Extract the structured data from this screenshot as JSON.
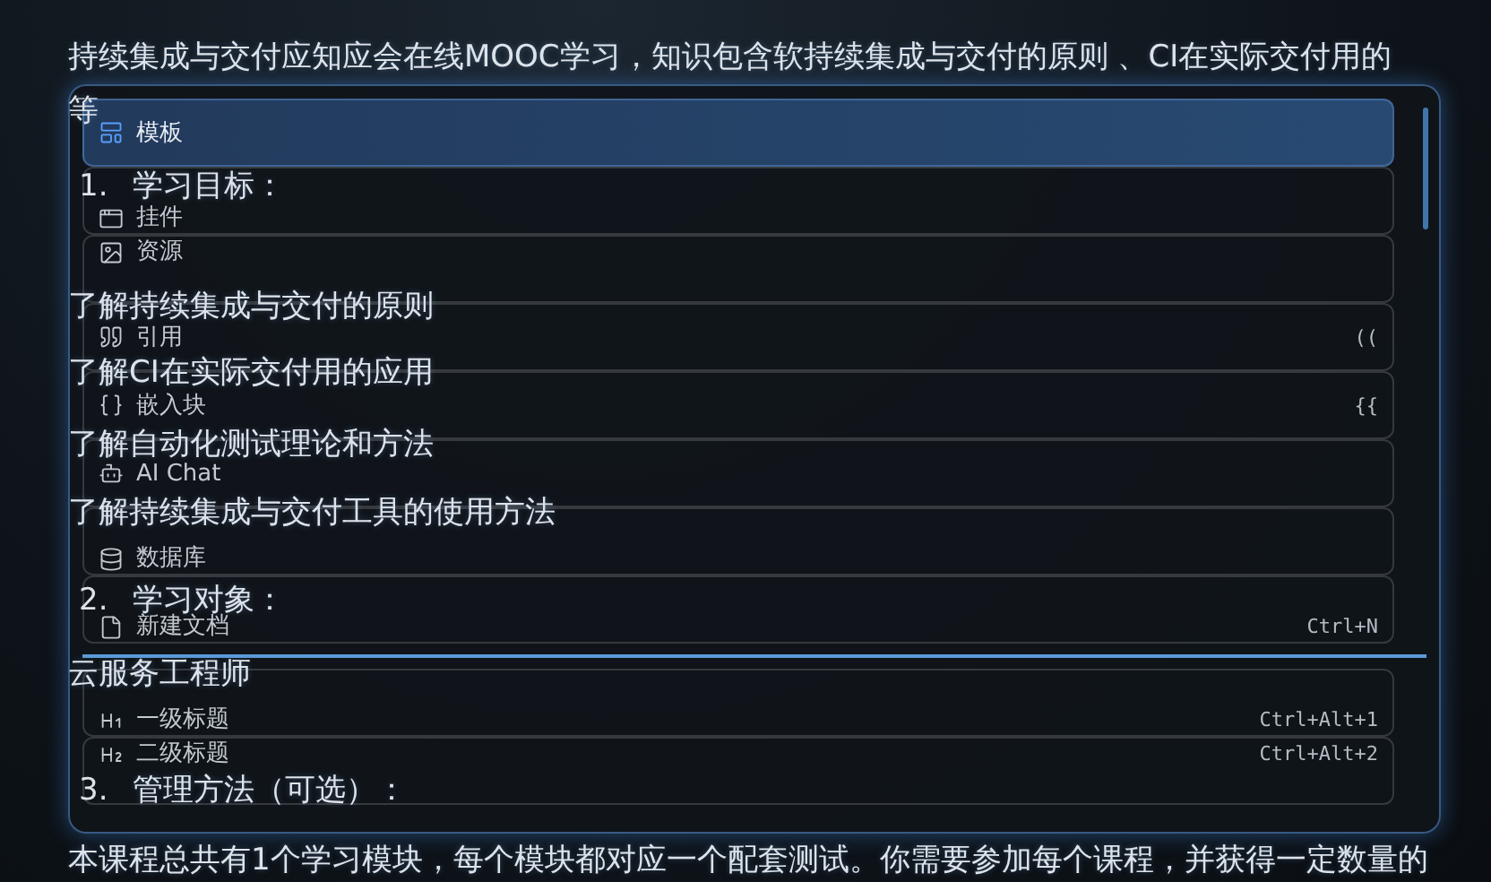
{
  "document": {
    "blocks": [
      {
        "kind": "text",
        "text": "持续集成与交付应知应会在线MOOC学习，知识包含软持续集成与交付的原则 、CI在实际交付用的"
      },
      {
        "kind": "text",
        "text": "等"
      },
      {
        "kind": "numbered",
        "number": "1.",
        "text": "学习目标："
      },
      {
        "kind": "text",
        "text": "了解持续集成与交付的原则"
      },
      {
        "kind": "text",
        "text": "了解CI在实际交付用的应用"
      },
      {
        "kind": "text",
        "text": "了解自动化测试理论和方法"
      },
      {
        "kind": "text",
        "text": "了解持续集成与交付工具的使用方法"
      },
      {
        "kind": "numbered",
        "number": "2.",
        "text": "学习对象："
      },
      {
        "kind": "text",
        "text": "云服务工程师"
      },
      {
        "kind": "numbered",
        "number": "3.",
        "text": "管理方法（可选）："
      },
      {
        "kind": "text",
        "text": "本课程总共有1个学习模块，每个模块都对应一个配套测试。你需要参加每个课程，并获得一定数量的"
      }
    ]
  },
  "menu": {
    "items": [
      {
        "kind": "item",
        "label": "模板",
        "selected": true
      },
      {
        "kind": "item",
        "label": "挂件",
        "selected": false
      },
      {
        "kind": "item",
        "label": "资源",
        "selected": false
      },
      {
        "kind": "item",
        "label": "引用",
        "shortcut": "((",
        "selected": false
      },
      {
        "kind": "item",
        "label": "嵌入块",
        "shortcut": "{{",
        "selected": false
      },
      {
        "kind": "item",
        "label": "AI Chat",
        "selected": false
      },
      {
        "kind": "item",
        "label": "数据库",
        "selected": false
      },
      {
        "kind": "item",
        "label": "新建文档",
        "shortcut": "Ctrl+N",
        "selected": false
      },
      {
        "kind": "separator"
      },
      {
        "kind": "item",
        "label": "一级标题",
        "shortcut": "Ctrl+Alt+1",
        "selected": false
      },
      {
        "kind": "item",
        "label": "二级标题",
        "shortcut": "Ctrl+Alt+2",
        "selected": false
      }
    ]
  }
}
